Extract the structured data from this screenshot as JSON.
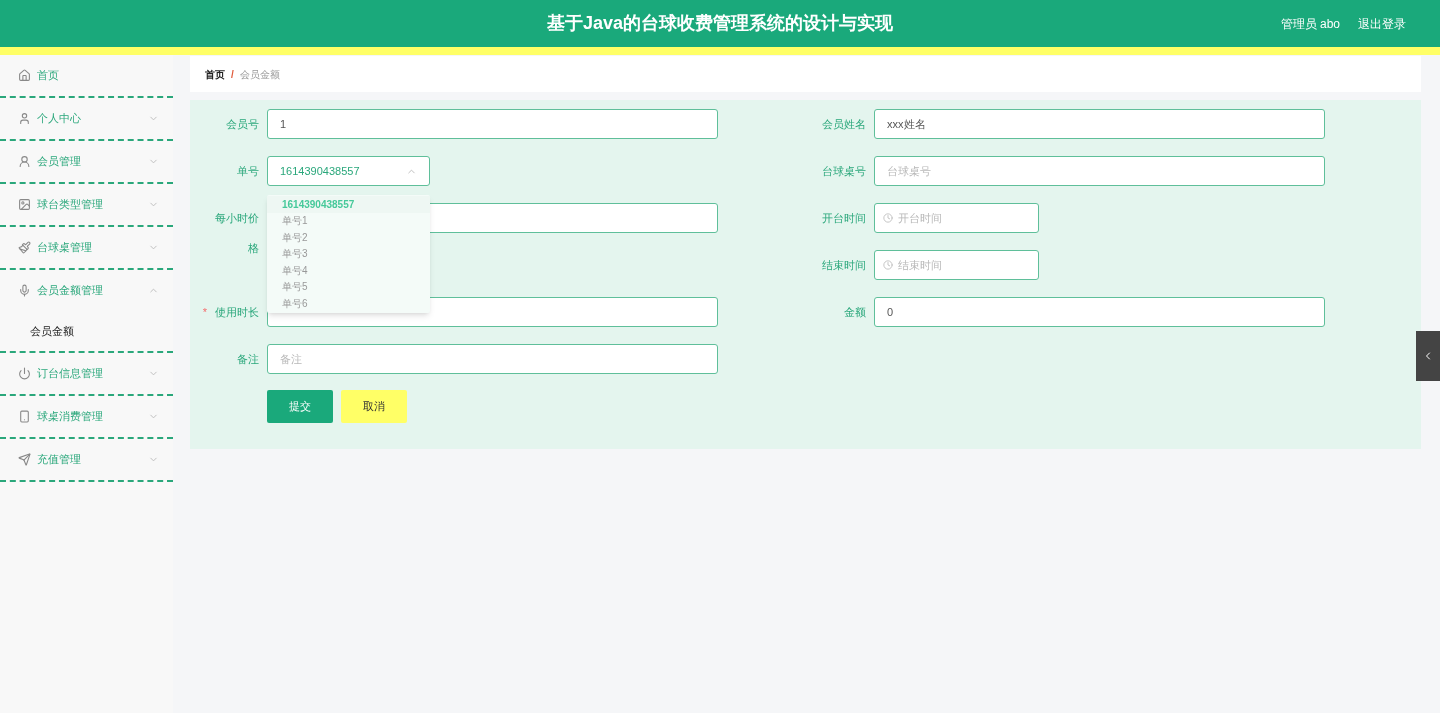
{
  "header": {
    "title": "基于Java的台球收费管理系统的设计与实现",
    "user": "管理员 abo",
    "logout": "退出登录"
  },
  "sidebar": {
    "items": [
      {
        "label": "首页"
      },
      {
        "label": "个人中心",
        "expanded": false
      },
      {
        "label": "会员管理",
        "expanded": false
      },
      {
        "label": "球台类型管理",
        "expanded": false
      },
      {
        "label": "台球桌管理",
        "expanded": false
      },
      {
        "label": "会员金额管理",
        "expanded": true,
        "children": [
          {
            "label": "会员金额",
            "selected": true
          }
        ]
      },
      {
        "label": "订台信息管理",
        "expanded": false
      },
      {
        "label": "球桌消费管理",
        "expanded": false
      },
      {
        "label": "充值管理",
        "expanded": false
      }
    ]
  },
  "breadcrumb": {
    "items": [
      "首页",
      "会员金额"
    ],
    "separator": "/"
  },
  "form": {
    "rows": [
      {
        "left": {
          "label": "会员号",
          "kind": "text",
          "value": "1"
        },
        "right": {
          "label": "会员姓名",
          "kind": "text",
          "value": "xxx姓名"
        }
      },
      {
        "left": {
          "label": "单号",
          "kind": "select",
          "value": "1614390438557",
          "expanded": true,
          "options": [
            {
              "label": "1614390438557",
              "selected": true
            },
            {
              "label": "单号1",
              "selected": false
            },
            {
              "label": "单号2",
              "selected": false
            },
            {
              "label": "单号3",
              "selected": false
            },
            {
              "label": "单号4",
              "selected": false
            },
            {
              "label": "单号5",
              "selected": false
            },
            {
              "label": "单号6",
              "selected": false
            }
          ]
        },
        "right": {
          "label": "台球桌号",
          "kind": "text",
          "placeholder": "台球桌号"
        }
      },
      {
        "left": {
          "label": "每小时价格",
          "kind": "text"
        },
        "right": {
          "label": "开台时间",
          "kind": "date",
          "placeholder": "开台时间"
        }
      },
      {
        "right": {
          "label": "结束时间",
          "kind": "date",
          "placeholder": "结束时间"
        }
      },
      {
        "left": {
          "label": "使用时长",
          "kind": "text",
          "required_mark": "*"
        },
        "right": {
          "label": "金额",
          "kind": "text",
          "value": "0"
        }
      },
      {
        "left": {
          "label": "备注",
          "kind": "text",
          "placeholder": "备注"
        }
      }
    ],
    "buttons": [
      {
        "label": "提交",
        "kind": "primary"
      },
      {
        "label": "取消",
        "kind": "cancel"
      }
    ]
  }
}
